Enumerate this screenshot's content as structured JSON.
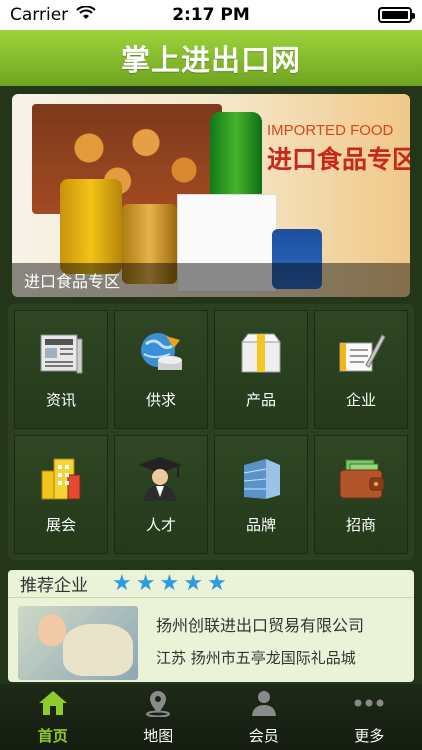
{
  "status_bar": {
    "carrier": "Carrier",
    "time": "2:17 PM"
  },
  "header": {
    "title": "掌上进出口网"
  },
  "banner": {
    "caption": "进口食品专区",
    "heading_en": "IMPORTED FOOD",
    "heading_zh": "进口食品专区"
  },
  "categories": [
    {
      "label": "资讯",
      "icon": "newspaper-icon"
    },
    {
      "label": "供求",
      "icon": "globe-exchange-icon"
    },
    {
      "label": "产品",
      "icon": "box-icon"
    },
    {
      "label": "企业",
      "icon": "document-pen-icon"
    },
    {
      "label": "展会",
      "icon": "buildings-icon"
    },
    {
      "label": "人才",
      "icon": "graduate-icon"
    },
    {
      "label": "品牌",
      "icon": "skyscraper-icon"
    },
    {
      "label": "招商",
      "icon": "wallet-icon"
    }
  ],
  "recommended": {
    "title": "推荐企业",
    "rating": 5,
    "company_name": "扬州创联进出口贸易有限公司",
    "address": "江苏 扬州市五亭龙国际礼品城"
  },
  "tabs": [
    {
      "label": "首页",
      "icon": "home-icon",
      "active": true
    },
    {
      "label": "地图",
      "icon": "map-pin-icon",
      "active": false
    },
    {
      "label": "会员",
      "icon": "user-icon",
      "active": false
    },
    {
      "label": "更多",
      "icon": "more-icon",
      "active": false
    }
  ],
  "colors": {
    "accent": "#8ecb2b",
    "header": "#7fb82a",
    "star": "#2e9bdc",
    "background": "#24361a"
  }
}
